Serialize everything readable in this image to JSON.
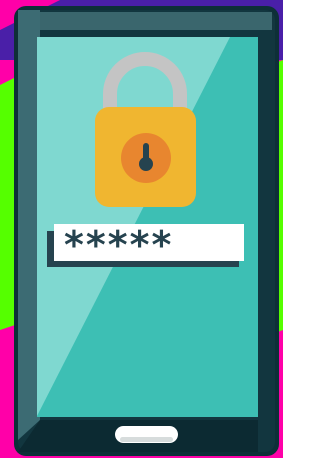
{
  "password": {
    "masked_value": "*****"
  },
  "icons": {
    "lock": "padlock-icon",
    "keyhole": "keyhole-icon",
    "home_button": "home-button"
  },
  "colors": {
    "background_magenta": "#ff00a8",
    "background_green": "#55ff00",
    "background_purple": "#4a1fa8",
    "phone_body": "#0e2f38",
    "screen_light": "#7fd8d0",
    "screen_dark": "#3dbfb4",
    "lock_body": "#f0b630",
    "lock_shackle": "#c4c4c4",
    "lock_circle": "#e8862f",
    "keyhole": "#26434f",
    "field_text": "#26434f"
  }
}
